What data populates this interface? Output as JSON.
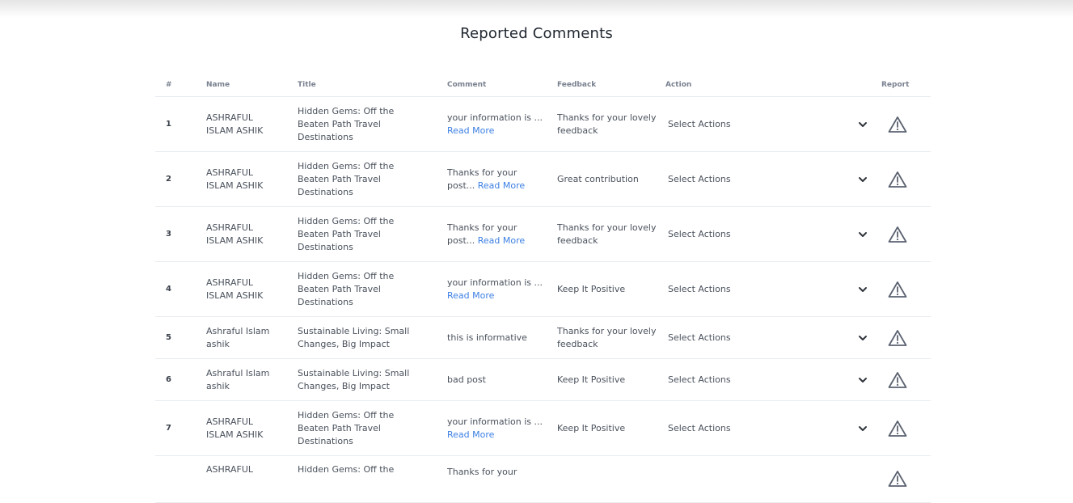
{
  "page": {
    "title": "Reported Comments"
  },
  "table": {
    "headers": {
      "num": "#",
      "name": "Name",
      "title": "Title",
      "comment": "Comment",
      "feedback": "Feedback",
      "action": "Action",
      "report": "Report"
    },
    "read_more": "Read More",
    "select_placeholder": "Select Actions",
    "rows": [
      {
        "num": "1",
        "name": "ASHRAFUL ISLAM ASHIK",
        "title": "Hidden Gems: Off the Beaten Path Travel Destinations",
        "comment": "your information is ...",
        "feedback": "Thanks for your lovely feedback",
        "action": "Select Actions"
      },
      {
        "num": "2",
        "name": "ASHRAFUL ISLAM ASHIK",
        "title": "Hidden Gems: Off the Beaten Path Travel Destinations",
        "comment": "Thanks for your post...",
        "feedback": "Great contribution",
        "action": "Select Actions"
      },
      {
        "num": "3",
        "name": "ASHRAFUL ISLAM ASHIK",
        "title": "Hidden Gems: Off the Beaten Path Travel Destinations",
        "comment": "Thanks for your post...",
        "feedback": "Thanks for your lovely feedback",
        "action": "Select Actions"
      },
      {
        "num": "4",
        "name": "ASHRAFUL ISLAM ASHIK",
        "title": "Hidden Gems: Off the Beaten Path Travel Destinations",
        "comment": "your information is ...",
        "feedback": "Keep It Positive",
        "action": "Select Actions"
      },
      {
        "num": "5",
        "name": "Ashraful Islam ashik",
        "title": "Sustainable Living: Small Changes, Big Impact",
        "comment": "this is informative",
        "feedback": "Thanks for your lovely feedback",
        "action": "Select Actions"
      },
      {
        "num": "6",
        "name": "Ashraful Islam ashik",
        "title": "Sustainable Living: Small Changes, Big Impact",
        "comment": "bad post",
        "feedback": "Keep It Positive",
        "action": "Select Actions"
      },
      {
        "num": "7",
        "name": "ASHRAFUL ISLAM ASHIK",
        "title": "Hidden Gems: Off the Beaten Path Travel Destinations",
        "comment": "your information is ...",
        "feedback": "Keep It Positive",
        "action": "Select Actions"
      },
      {
        "num": "",
        "name": "ASHRAFUL",
        "title": "Hidden Gems: Off the",
        "comment": "Thanks for your",
        "feedback": "",
        "action": ""
      }
    ]
  },
  "icons": {
    "chevron": "chevron-down-icon",
    "report": "warning-triangle-icon"
  },
  "colors": {
    "link": "#3d80e3",
    "icon": "#5b6270",
    "border": "#e9ecf0"
  }
}
